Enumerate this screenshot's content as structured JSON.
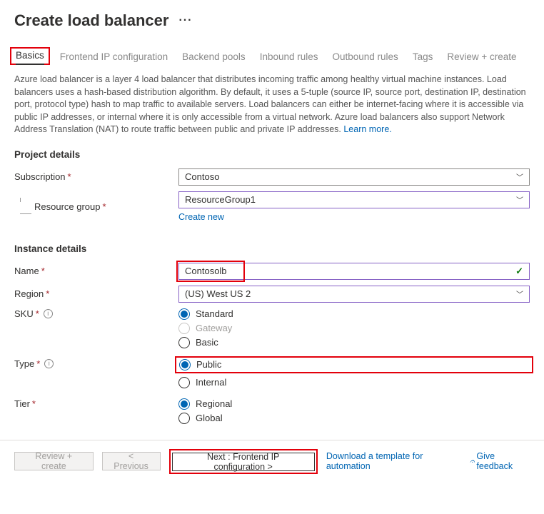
{
  "header": {
    "title": "Create load balancer"
  },
  "tabs": {
    "basics": "Basics",
    "frontend": "Frontend IP configuration",
    "backend": "Backend pools",
    "inbound": "Inbound rules",
    "outbound": "Outbound rules",
    "tags": "Tags",
    "review": "Review + create"
  },
  "description": {
    "text": "Azure load balancer is a layer 4 load balancer that distributes incoming traffic among healthy virtual machine instances. Load balancers uses a hash-based distribution algorithm. By default, it uses a 5-tuple (source IP, source port, destination IP, destination port, protocol type) hash to map traffic to available servers. Load balancers can either be internet-facing where it is accessible via public IP addresses, or internal where it is only accessible from a virtual network. Azure load balancers also support Network Address Translation (NAT) to route traffic between public and private IP addresses.  ",
    "learn_more": "Learn more."
  },
  "sections": {
    "project": "Project details",
    "instance": "Instance details"
  },
  "labels": {
    "subscription": "Subscription",
    "resource_group": "Resource group",
    "create_new": "Create new",
    "name": "Name",
    "region": "Region",
    "sku": "SKU",
    "type": "Type",
    "tier": "Tier"
  },
  "values": {
    "subscription": "Contoso",
    "resource_group": "ResourceGroup1",
    "name": "Contosolb",
    "region": "(US) West US 2"
  },
  "options": {
    "sku": {
      "standard": "Standard",
      "gateway": "Gateway",
      "basic": "Basic"
    },
    "type": {
      "public": "Public",
      "internal": "Internal"
    },
    "tier": {
      "regional": "Regional",
      "global": "Global"
    }
  },
  "footer": {
    "review": "Review + create",
    "previous": "< Previous",
    "next": "Next : Frontend IP configuration >",
    "download": "Download a template for automation",
    "feedback": "Give feedback"
  }
}
